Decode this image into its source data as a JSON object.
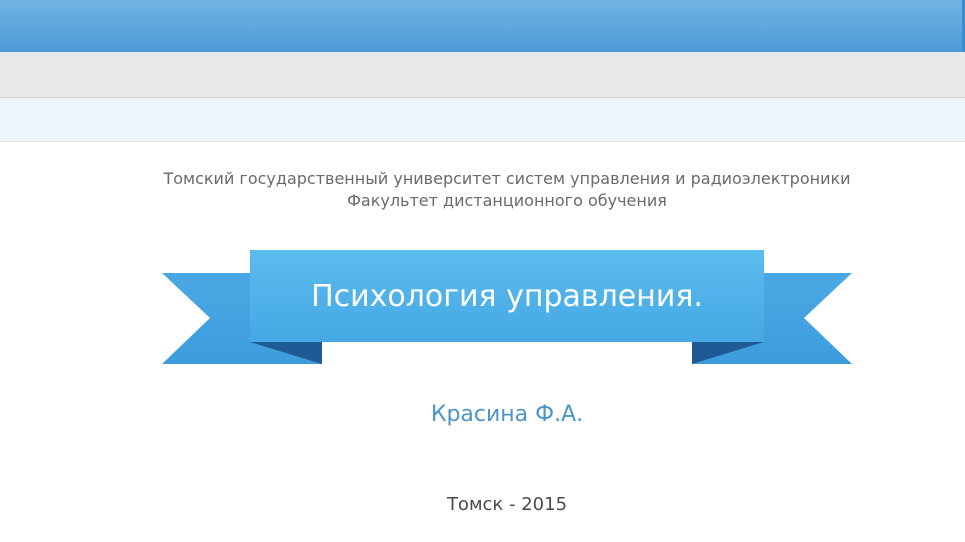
{
  "header": {
    "university": "Томский государственный университет систем управления и радиоэлектроники",
    "faculty": "Факультет дистанционного обучения"
  },
  "banner": {
    "title": "Психология управления."
  },
  "author": "Красина Ф.А.",
  "city_year": "Томск - 2015",
  "colors": {
    "top_bar": "#5ea8dd",
    "gray_bar": "#e8e8e8",
    "light_bar": "#eef5fd",
    "ribbon_main": "#4fb0e8",
    "ribbon_tail": "#3e9fdd",
    "ribbon_fold": "#1f5a94",
    "author_text": "#4d95c8"
  }
}
